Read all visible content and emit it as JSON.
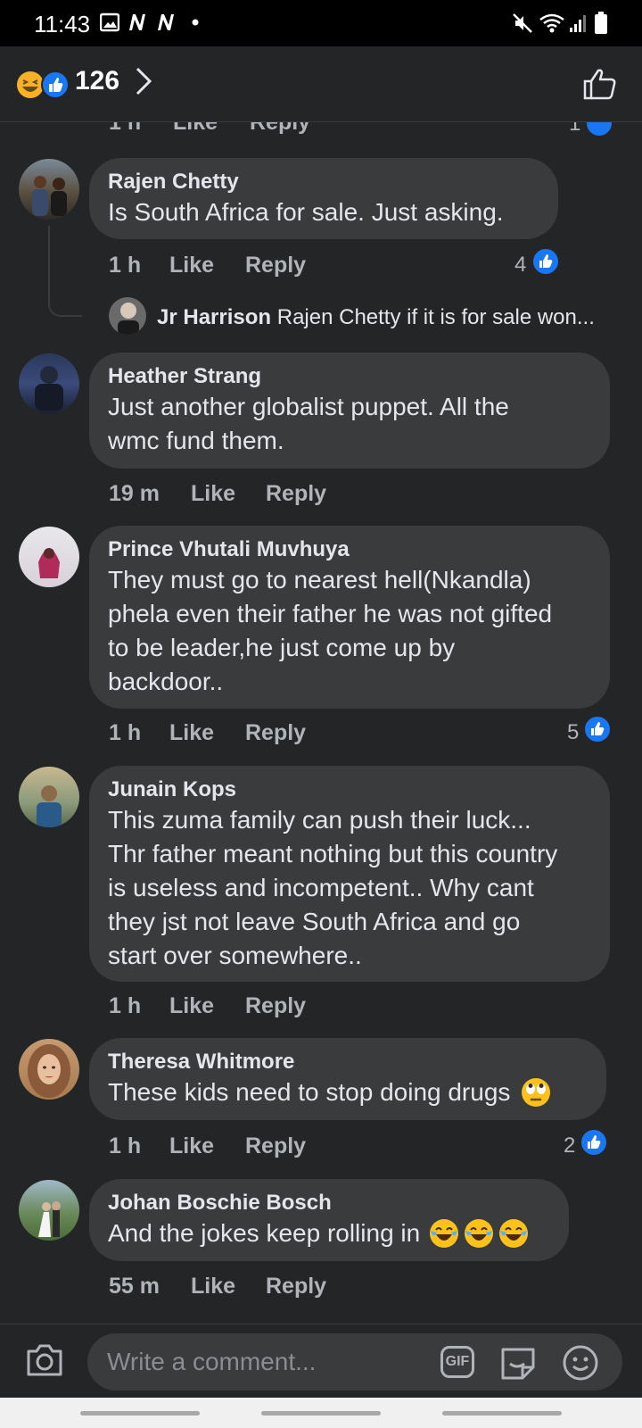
{
  "status_bar": {
    "time": "11:43"
  },
  "reaction_header": {
    "count": "126"
  },
  "partial_row": {
    "time": "1 h",
    "like": "Like",
    "reply": "Reply",
    "likes": "1"
  },
  "comments": [
    {
      "author": "Rajen Chetty",
      "lines": [
        "Is South Africa for sale. Just asking."
      ],
      "time": "1 h",
      "like": "Like",
      "reply": "Reply",
      "likes": "4"
    },
    {
      "author": "Heather Strang",
      "lines": [
        "Just another globalist puppet. All the",
        "wmc fund them."
      ],
      "time": "19 m",
      "like": "Like",
      "reply": "Reply"
    },
    {
      "author": "Prince Vhutali Muvhuya",
      "lines": [
        "They must go to nearest hell(Nkandla)",
        "phela even their father he was not gifted",
        "to be leader,he just come up by",
        "backdoor.."
      ],
      "time": "1 h",
      "like": "Like",
      "reply": "Reply",
      "likes": "5"
    },
    {
      "author": "Junain Kops",
      "lines": [
        "This zuma family can push their luck...",
        "Thr father meant nothing but this country",
        "is useless and incompetent.. Why cant",
        "they jst not leave South Africa and go",
        "start over somewhere.."
      ],
      "time": "1 h",
      "like": "Like",
      "reply": "Reply"
    },
    {
      "author": "Theresa Whitmore",
      "lines": [
        "These kids need to stop doing drugs"
      ],
      "time": "1 h",
      "like": "Like",
      "reply": "Reply",
      "likes": "2"
    },
    {
      "author": "Johan Boschie Bosch",
      "lines": [
        "And the jokes keep rolling in"
      ],
      "time": "55 m",
      "like": "Like",
      "reply": "Reply"
    }
  ],
  "reply_preview": {
    "author": "Jr Harrison",
    "text": "Rajen Chetty if it is for sale won..."
  },
  "composer": {
    "placeholder": "Write a comment...",
    "gif_label": "GIF"
  },
  "icons": {
    "reactions": [
      "haha-reaction-icon",
      "like-reaction-icon"
    ],
    "composer": [
      "camera-icon",
      "gif-icon",
      "sticker-icon",
      "emoji-icon"
    ],
    "inline_emoji": [
      "face-with-rolling-eyes",
      "face-with-tears-of-joy"
    ]
  },
  "colors": {
    "background": "#242526",
    "bubble": "#3a3b3c",
    "like_blue": "#1877f2",
    "muted_text": "#b0b3b8"
  }
}
